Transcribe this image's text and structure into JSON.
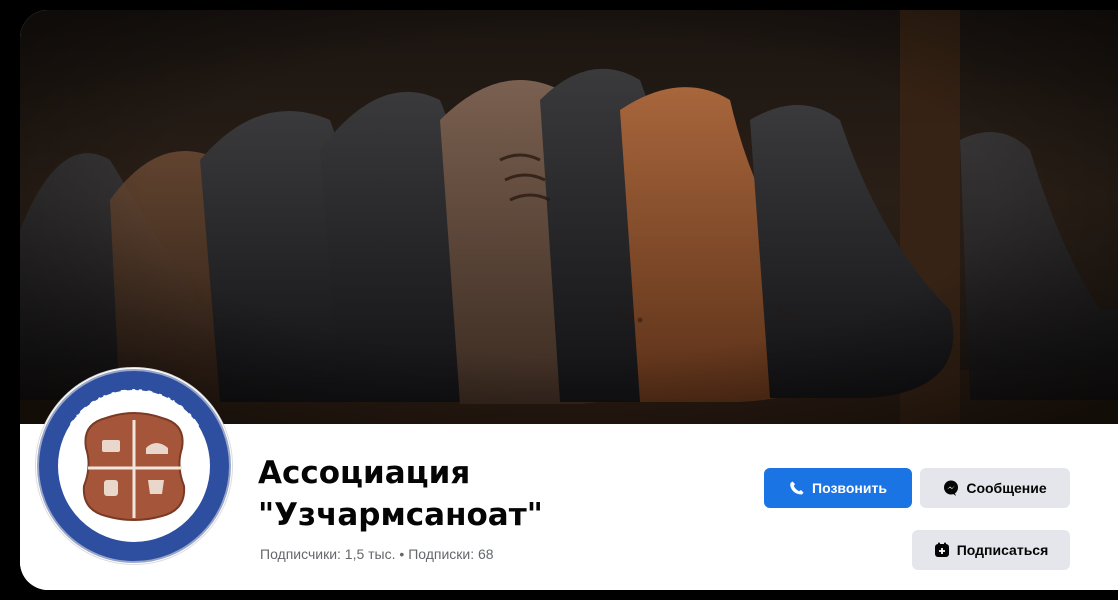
{
  "page": {
    "name_line1": "Ассоциация",
    "name_line2": "\"Узчармсаноат\"",
    "stats": "Подписчики: 1,5 тыс. • Подписки: 68"
  },
  "logo": {
    "text_top": "O'ZCHARMSANOAT",
    "text_bottom": "UZCHARMSANOAT"
  },
  "actions": {
    "call_label": "Позвонить",
    "message_label": "Сообщение",
    "subscribe_label": "Подписаться"
  },
  "icons": {
    "call": "phone-icon",
    "message": "messenger-icon",
    "subscribe": "subscribe-icon"
  },
  "colors": {
    "primary_button": "#1b74e4",
    "secondary_button": "#e4e6eb",
    "logo_ring": "#2e4fa0",
    "logo_leather": "#a5553a"
  }
}
